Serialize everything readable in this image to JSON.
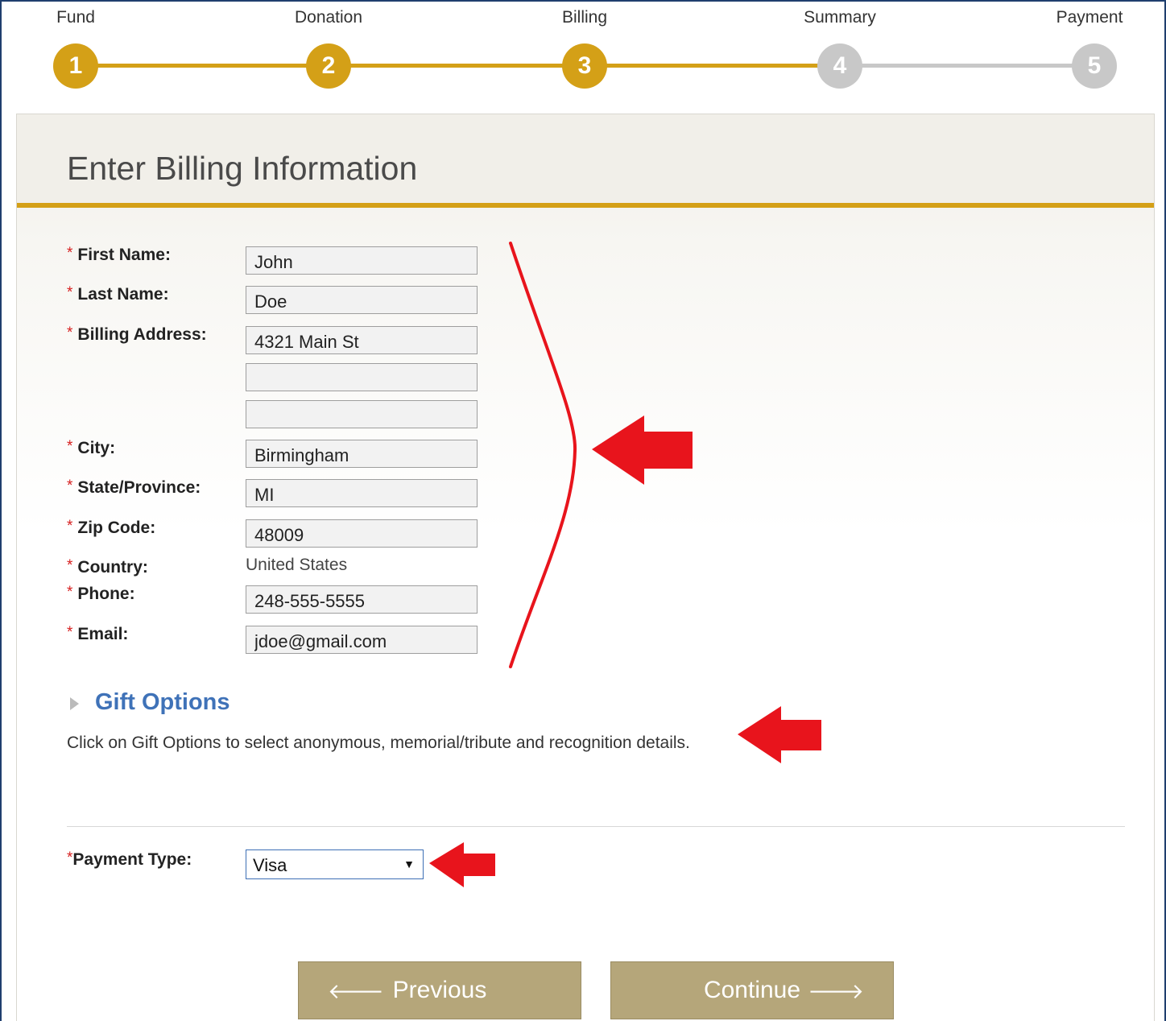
{
  "progress": {
    "steps": [
      {
        "label": "Fund",
        "number": "1",
        "state": "done"
      },
      {
        "label": "Donation",
        "number": "2",
        "state": "done"
      },
      {
        "label": "Billing",
        "number": "3",
        "state": "current"
      },
      {
        "label": "Summary",
        "number": "4",
        "state": "todo"
      },
      {
        "label": "Payment",
        "number": "5",
        "state": "todo"
      }
    ],
    "active_color": "#d4a017",
    "inactive_color": "#c8c8c8"
  },
  "panel": {
    "title": "Enter Billing Information"
  },
  "form": {
    "required_mark": "*",
    "first_name": {
      "label": "First Name:",
      "value": "John"
    },
    "last_name": {
      "label": "Last Name:",
      "value": "Doe"
    },
    "billing_address": {
      "label": "Billing Address:",
      "line1": "4321 Main St",
      "line2": "",
      "line3": ""
    },
    "city": {
      "label": "City:",
      "value": "Birmingham"
    },
    "state": {
      "label": "State/Province:",
      "value": "MI"
    },
    "zip": {
      "label": "Zip Code:",
      "value": "48009"
    },
    "country": {
      "label": "Country:",
      "value": "United States"
    },
    "phone": {
      "label": "Phone:",
      "value": "248-555-5555"
    },
    "email": {
      "label": "Email:",
      "value": "jdoe@gmail.com"
    }
  },
  "gift_options": {
    "title": "Gift Options",
    "description": "Click on Gift Options to select anonymous, memorial/tribute and recognition details."
  },
  "payment": {
    "label": "Payment Type:",
    "selected": "Visa"
  },
  "buttons": {
    "previous": "Previous",
    "continue": "Continue"
  },
  "annotation_color": "#e8141c"
}
